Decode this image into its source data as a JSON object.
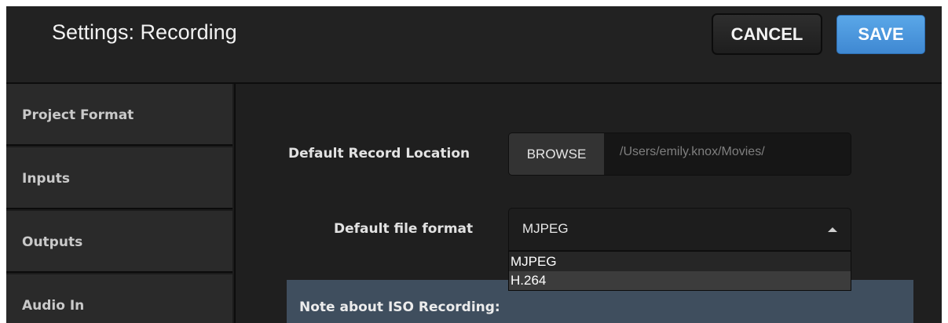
{
  "header": {
    "title": "Settings: Recording",
    "cancel_label": "CANCEL",
    "save_label": "SAVE"
  },
  "sidebar": {
    "items": [
      {
        "label": "Project Format"
      },
      {
        "label": "Inputs"
      },
      {
        "label": "Outputs"
      },
      {
        "label": "Audio In"
      }
    ]
  },
  "form": {
    "record_location": {
      "label": "Default Record Location",
      "browse_label": "BROWSE",
      "path": "/Users/emily.knox/Movies/"
    },
    "file_format": {
      "label": "Default file format",
      "selected": "MJPEG",
      "options": [
        "MJPEG",
        "H.264"
      ],
      "hovered_option": "H.264"
    }
  },
  "note": {
    "title": "Note about ISO Recording:"
  },
  "colors": {
    "save_button": "#4a96dd",
    "note_background": "#3f4e5e",
    "panel_background": "#1f1f1f"
  },
  "icons": {
    "dropdown_caret": "caret-up-icon"
  }
}
